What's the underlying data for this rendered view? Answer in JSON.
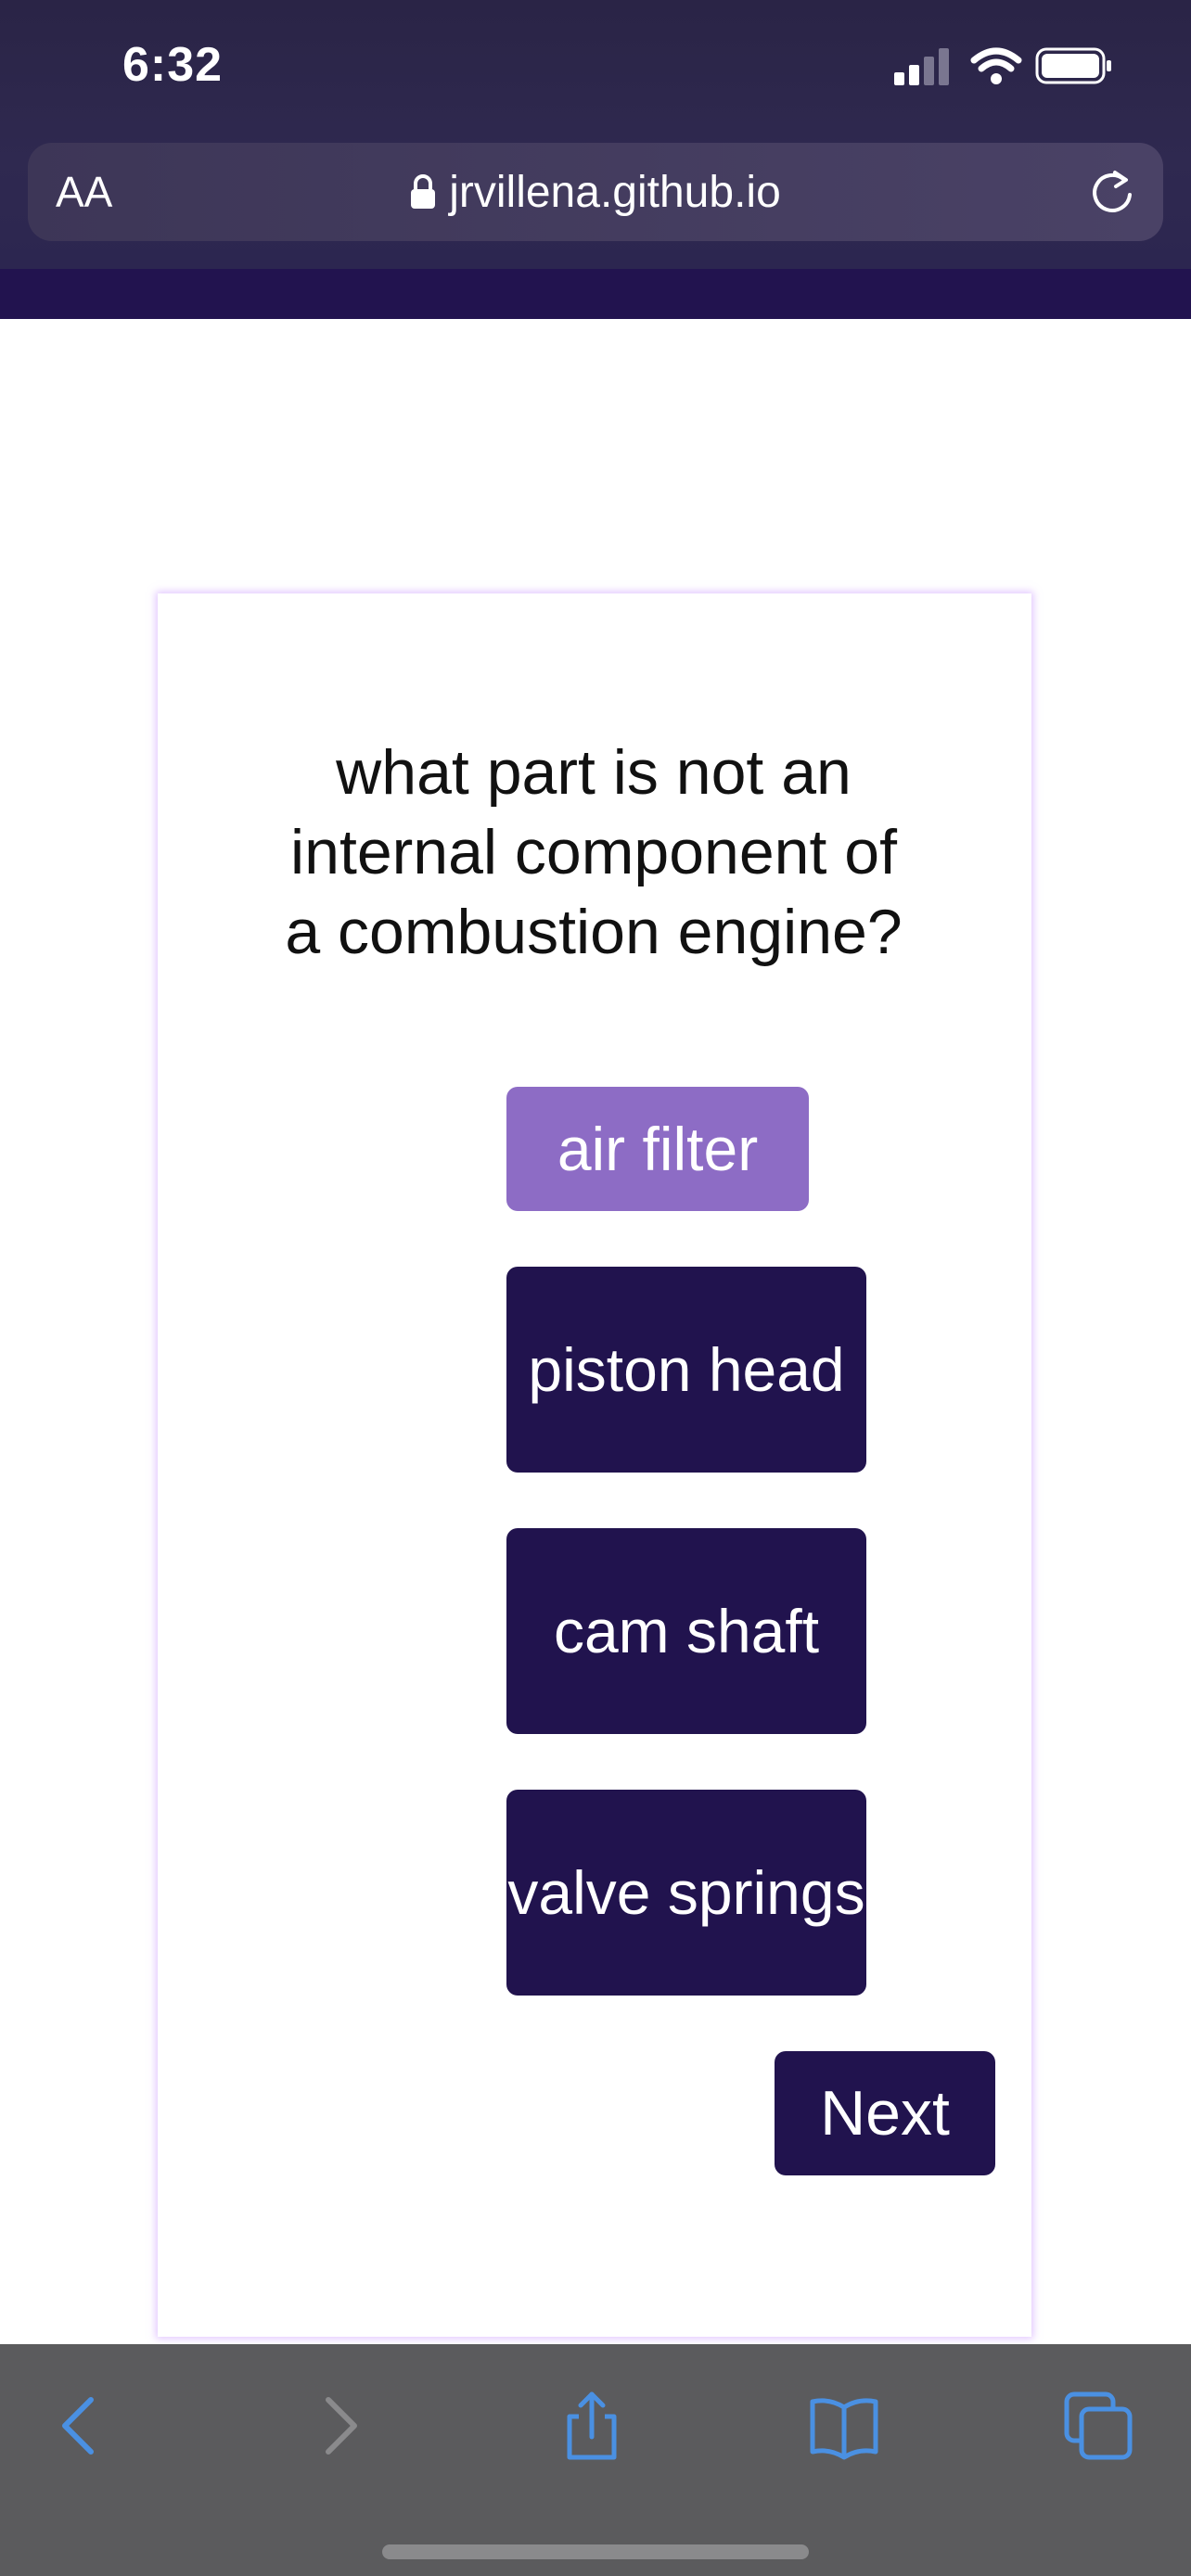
{
  "status_bar": {
    "time": "6:32",
    "icons": [
      "signal-icon",
      "wifi-icon",
      "battery-icon"
    ]
  },
  "browser": {
    "text_size_label": "AA",
    "url": "jrvillena.github.io",
    "icons": [
      "lock-icon",
      "reload-icon"
    ]
  },
  "quiz": {
    "question": "what part is not an internal component of a combustion engine?",
    "answers": [
      {
        "label": "air filter",
        "selected": true
      },
      {
        "label": "piston head",
        "selected": false
      },
      {
        "label": "cam shaft",
        "selected": false
      },
      {
        "label": "valve springs",
        "selected": false
      }
    ],
    "next_label": "Next"
  },
  "toolbar": {
    "items": [
      "back-icon",
      "forward-icon",
      "share-icon",
      "bookmarks-icon",
      "tabs-icon"
    ]
  },
  "colors": {
    "selected_answer": "#8d6cc5",
    "answer": "#21134e",
    "header_band": "#22134f",
    "toolbar_icon_active": "#4a90e2",
    "toolbar_icon_disabled": "#8a8a8c"
  }
}
